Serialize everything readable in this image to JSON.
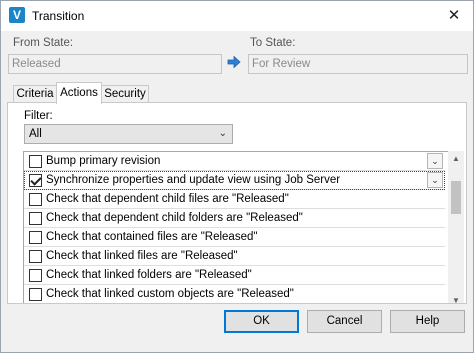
{
  "window": {
    "title": "Transition",
    "app_icon_letter": "V",
    "close_glyph": "✕"
  },
  "from_state": {
    "label": "From State:",
    "value": "Released"
  },
  "to_state": {
    "label": "To State:",
    "value": "For Review"
  },
  "tabs": [
    {
      "label": "Criteria",
      "active": false
    },
    {
      "label": "Actions",
      "active": true
    },
    {
      "label": "Security",
      "active": false
    }
  ],
  "filter": {
    "label": "Filter:",
    "value": "All"
  },
  "actions": [
    {
      "label": "Bump primary revision",
      "checked": false,
      "has_dropdown": true
    },
    {
      "label": "Synchronize properties and update view using Job Server",
      "checked": true,
      "has_dropdown": true
    },
    {
      "label": "Check that dependent child files are \"Released\"",
      "checked": false
    },
    {
      "label": "Check that dependent child folders are \"Released\"",
      "checked": false
    },
    {
      "label": "Check that contained files are \"Released\"",
      "checked": false
    },
    {
      "label": "Check that linked files are \"Released\"",
      "checked": false
    },
    {
      "label": "Check that linked folders are \"Released\"",
      "checked": false
    },
    {
      "label": "Check that linked custom objects are \"Released\"",
      "checked": false
    }
  ],
  "buttons": {
    "ok": "OK",
    "cancel": "Cancel",
    "help": "Help"
  },
  "icons": {
    "chevron_down": "⌄",
    "scroll_up": "▲",
    "scroll_down": "▼",
    "arrow": "right-arrow-icon"
  },
  "colors": {
    "accent": "#0078d7",
    "arrow": "#2e7fd6",
    "app_icon": "#1a86c8"
  }
}
